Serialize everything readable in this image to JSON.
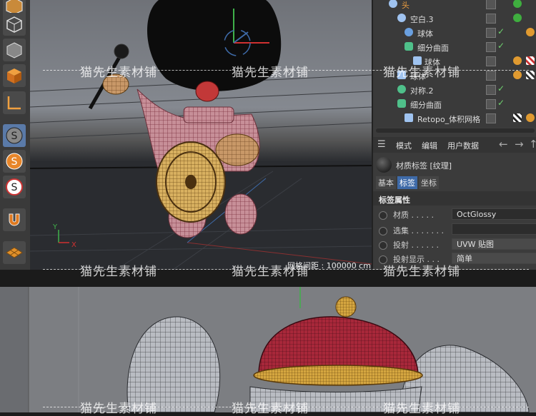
{
  "object_manager": {
    "items": [
      {
        "label": "头"
      },
      {
        "label": "空白.3"
      },
      {
        "label": "球体"
      },
      {
        "label": "细分曲面"
      },
      {
        "label": "球体"
      },
      {
        "label": "球体"
      },
      {
        "label": "对称.2"
      },
      {
        "label": "细分曲面"
      },
      {
        "label": "Retopo_体积网格"
      }
    ]
  },
  "attributes": {
    "menu": {
      "mode": "模式",
      "edit": "编辑",
      "user_data": "用户数据"
    },
    "tag_title": "材质标签 [纹理]",
    "tabs": {
      "basic": "基本",
      "tag": "标签",
      "coord": "坐标"
    },
    "section_title": "标签属性",
    "material_label": "材质 . . . . .",
    "material_value": "OctGlossy",
    "selection_label": "选集 . . . . . . .",
    "projection_label": "投射 . . . . . .",
    "projection_value": "UVW 贴图",
    "projection_display_label": "投射显示 . . .",
    "projection_display_value": "简单"
  },
  "viewport": {
    "grid_spacing": "网格间距 : 100000 cm",
    "axis_x": "X",
    "axis_y": "Y"
  },
  "watermark": {
    "text": "猫先生素材铺"
  },
  "colors": {
    "accent": "#3e6aa8",
    "check": "#6fd36f",
    "hat_red": "#a8283a"
  }
}
